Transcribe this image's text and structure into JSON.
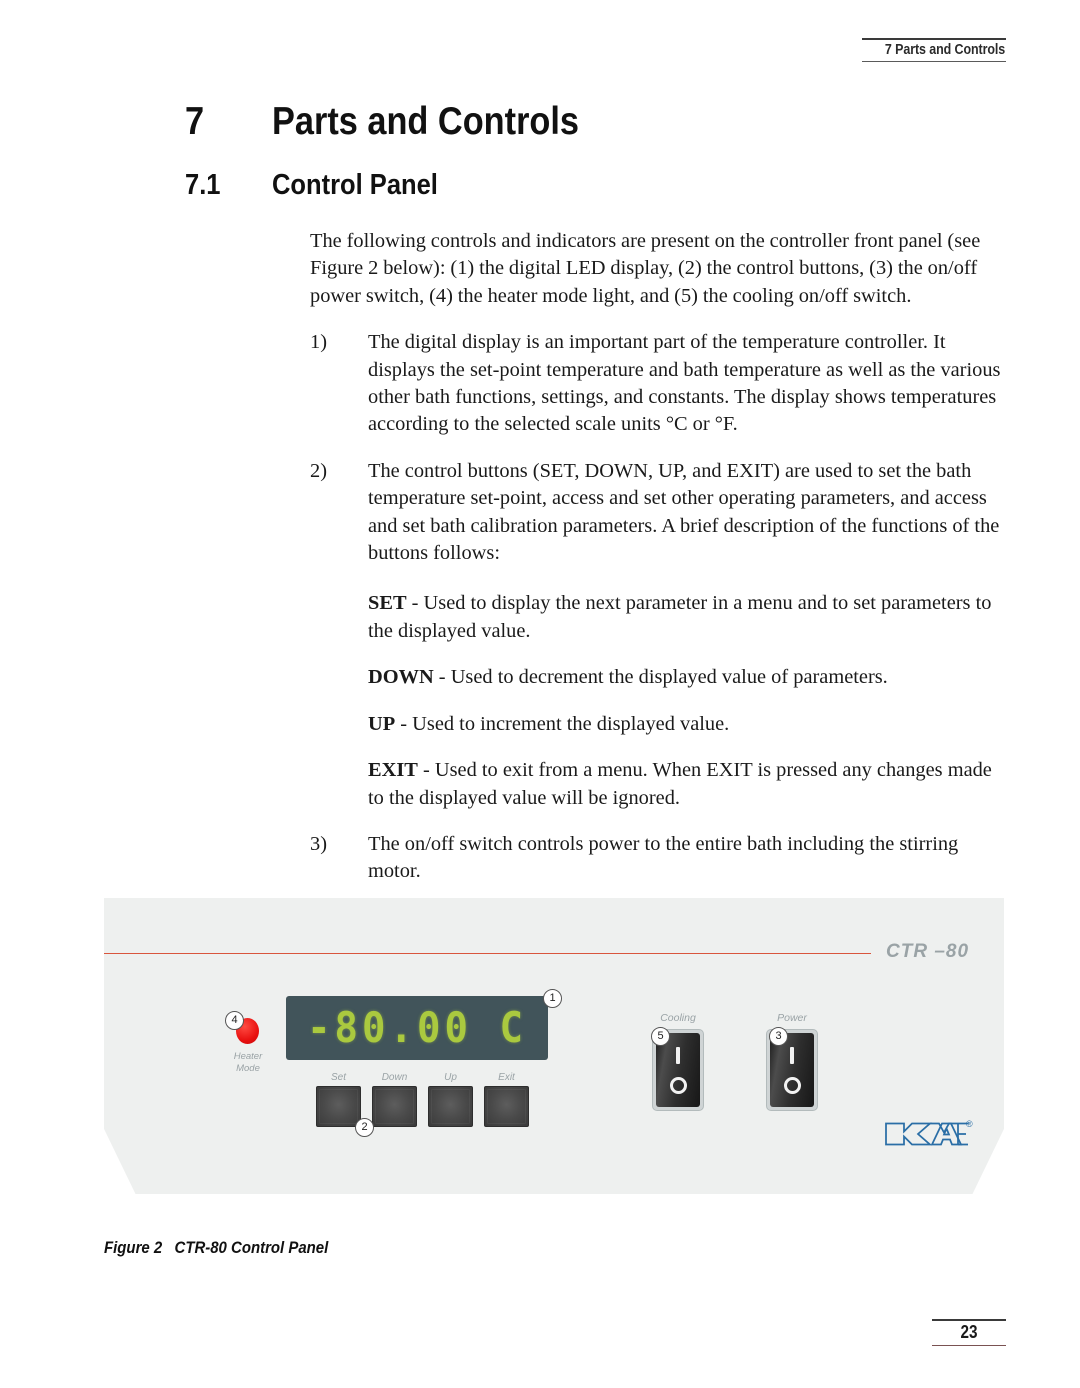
{
  "header": {
    "running_head": "7 Parts and Controls"
  },
  "headings": {
    "chapter_number": "7",
    "chapter_title": "Parts and Controls",
    "section_number": "7.1",
    "section_title": "Control Panel"
  },
  "body": {
    "intro": "The following controls and indicators are present on the controller front panel (see Figure 2 below): (1) the digital LED display, (2) the control buttons, (3) the on/off power switch, (4) the heater mode light, and (5) the cooling on/off switch.",
    "items": [
      {
        "marker": "1)",
        "text": "The digital display is an important part of the temperature controller. It displays the set-point temperature and bath temperature as well as the various other bath functions, settings, and constants. The display shows temperatures according to the selected scale units °C or °F."
      },
      {
        "marker": "2)",
        "text": "The control buttons (SET, DOWN, UP, and EXIT) are used to set the bath temperature set-point, access and set other operating parameters, and access and set bath calibration parameters. A brief description of the functions of the buttons follows:"
      },
      {
        "marker": "3)",
        "text": "The on/off switch controls power to the entire bath including the stirring motor."
      }
    ],
    "definitions": [
      {
        "term": "SET",
        "body": " - Used to display the next parameter in a menu and to set parameters to the displayed value."
      },
      {
        "term": "DOWN",
        "body": " - Used to decrement the displayed value of parameters."
      },
      {
        "term": "UP",
        "body": " - Used to increment the displayed value."
      },
      {
        "term": "EXIT",
        "body": " - Used to exit from a menu. When EXIT is pressed any changes made to the displayed value will be ignored."
      }
    ]
  },
  "figure": {
    "model_label": "CTR –80",
    "display_value": "-80.00 C",
    "heater_label_line1": "Heater",
    "heater_label_line2": "Mode",
    "buttons": [
      {
        "label": "Set"
      },
      {
        "label": "Down"
      },
      {
        "label": "Up"
      },
      {
        "label": "Exit"
      }
    ],
    "switches": [
      {
        "label": "Cooling",
        "on_mark": "I",
        "off_mark": "O"
      },
      {
        "label": "Power",
        "on_mark": "I",
        "off_mark": "O"
      }
    ],
    "brand": "KAYE",
    "brand_reg": "®",
    "callouts": {
      "c1": "1",
      "c2": "2",
      "c3": "3",
      "c4": "4",
      "c5": "5"
    },
    "caption_label": "Figure 2",
    "caption_text": "CTR-80 Control Panel",
    "colors": {
      "panel": "#eef0ef",
      "accent_line": "#d9553d",
      "led_background": "#41545a",
      "led_segment": "#aac93f",
      "heater_led": "#e8100f",
      "brand_blue": "#2a6ea6"
    }
  },
  "folio": {
    "page_number": "23"
  }
}
